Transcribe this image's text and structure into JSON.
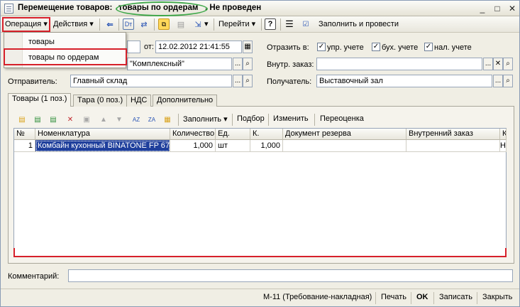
{
  "titlebar": {
    "title_part1": "Перемещение товаров:",
    "title_highlight": "товары по ордерам",
    "title_part3": ". Не проведен",
    "minimize": "_",
    "maximize": "□",
    "close": "✕"
  },
  "toolbar": {
    "operation_label": "Операция",
    "actions_label": "Действия",
    "goto_label": "Перейти",
    "help_label": "?",
    "fill_and_post_label": "Заполнить и провести",
    "dropdown_arrow": "▾"
  },
  "operation_menu": {
    "items": [
      {
        "label": "товары"
      },
      {
        "label": "товары по ордерам"
      }
    ]
  },
  "header": {
    "date_label": "от:",
    "date_value": "12.02.2012 21:41:55",
    "org_value": "\"Комплексный\"",
    "sender_label": "Отправитель:",
    "sender_value": "Главный склад",
    "reflect_label": "Отразить в:",
    "reflect_mgmt_label": "упр. учете",
    "reflect_acct_label": "бух. учете",
    "reflect_tax_label": "нал. учете",
    "internal_order_label": "Внутр. заказ:",
    "internal_order_value": "",
    "receiver_label": "Получатель:",
    "receiver_value": "Выставочный зал",
    "ellipsis": "...",
    "search_glyph": "⌕",
    "clear_glyph": "✕"
  },
  "tabs": [
    {
      "label": "Товары (1 поз.)"
    },
    {
      "label": "Тара (0 поз.)"
    },
    {
      "label": "НДС"
    },
    {
      "label": "Дополнительно"
    }
  ],
  "goods_toolbar": {
    "fill_label": "Заполнить",
    "selection_label": "Подбор",
    "change_label": "Изменить",
    "revaluation_label": "Переоценка"
  },
  "goods_table": {
    "columns": [
      "№",
      "Номенклатура",
      "Количество",
      "Ед.",
      "К.",
      "Документ резерва",
      "Внутренний заказ",
      "Ка"
    ],
    "rows": [
      {
        "num": "1",
        "item": "Комбайн кухонный BINATONE FP 67",
        "qty": "1,000",
        "unit": "шт",
        "k": "1,000",
        "reserve_doc": "",
        "internal_order": "",
        "extra": "Н"
      }
    ]
  },
  "comment": {
    "label": "Комментарий:",
    "value": ""
  },
  "statusbar": {
    "form_label": "М-11 (Требование-накладная)",
    "print_label": "Печать",
    "ok_label": "OK",
    "save_label": "Записать",
    "close_label": "Закрыть"
  },
  "colors": {
    "highlight_red": "#d6202a",
    "ellipse_green": "#3fa84a",
    "selection_blue": "#1f3f9c"
  }
}
